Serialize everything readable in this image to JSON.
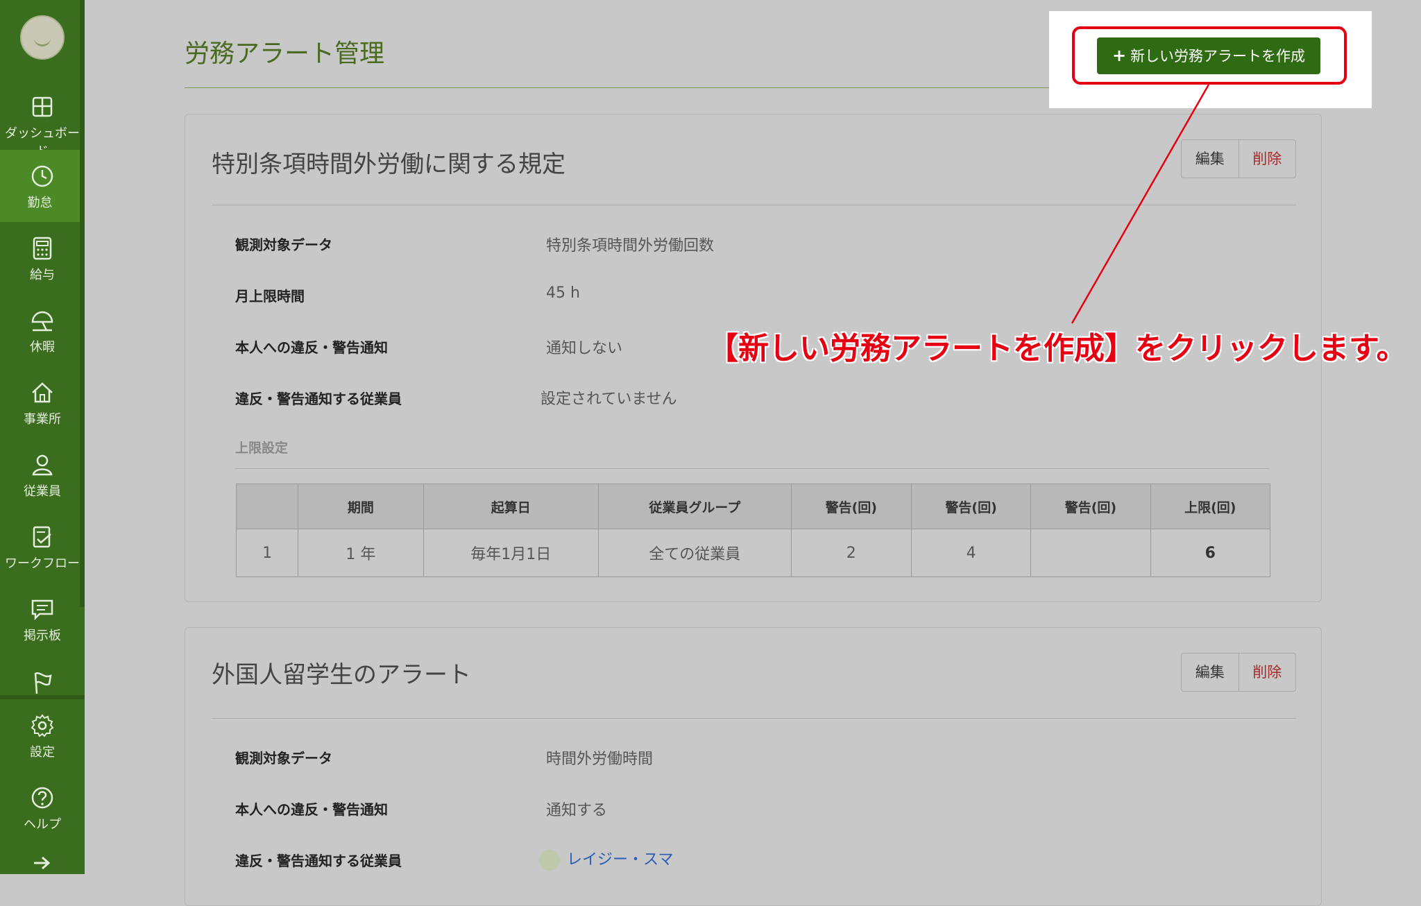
{
  "sidebar": {
    "items": [
      {
        "label": "ダッシュボード",
        "icon": "dashboard-icon"
      },
      {
        "label": "勤怠",
        "icon": "clock-icon"
      },
      {
        "label": "給与",
        "icon": "calculator-icon"
      },
      {
        "label": "休暇",
        "icon": "umbrella-icon"
      },
      {
        "label": "事業所",
        "icon": "home-icon"
      },
      {
        "label": "従業員",
        "icon": "person-icon"
      },
      {
        "label": "ワークフロー",
        "icon": "checklist-icon"
      },
      {
        "label": "掲示板",
        "icon": "message-icon"
      },
      {
        "label": "",
        "icon": "flag-icon"
      },
      {
        "label": "設定",
        "icon": "gear-icon"
      },
      {
        "label": "ヘルプ",
        "icon": "help-icon"
      }
    ]
  },
  "header": {
    "title": "労務アラート管理",
    "new_button": "新しい労務アラートを作成"
  },
  "callout": "【新しい労務アラートを作成】をクリックします。",
  "actions": {
    "edit": "編集",
    "delete": "削除"
  },
  "alerts": [
    {
      "title": "特別条項時間外労働に関する規定",
      "fields": [
        {
          "label": "観測対象データ",
          "value": "特別条項時間外労働回数"
        },
        {
          "label": "月上限時間",
          "value": "45 h"
        },
        {
          "label": "本人への違反・警告通知",
          "value": "通知しない"
        },
        {
          "label": "違反・警告通知する従業員",
          "value": "設定されていません"
        }
      ],
      "limits_heading": "上限設定",
      "table": {
        "headers": [
          "",
          "期間",
          "起算日",
          "従業員グループ",
          "警告(回)",
          "警告(回)",
          "警告(回)",
          "上限(回)"
        ],
        "rows": [
          [
            "1",
            "1 年",
            "毎年1月1日",
            "全ての従業員",
            "2",
            "4",
            "",
            "6"
          ]
        ]
      }
    },
    {
      "title": "外国人留学生のアラート",
      "fields": [
        {
          "label": "観測対象データ",
          "value": "時間外労働時間"
        },
        {
          "label": "本人への違反・警告通知",
          "value": "通知する"
        },
        {
          "label": "違反・警告通知する従業員",
          "value": "レイジー・スマ"
        }
      ]
    }
  ],
  "colors": {
    "sidebar": "#3a6e1e",
    "sidebar_active": "#4b8a26",
    "primary_button": "#2f6b12",
    "callout_red": "#e60012",
    "delete_red": "#a52a2a",
    "link_blue": "#2b5cb8"
  }
}
